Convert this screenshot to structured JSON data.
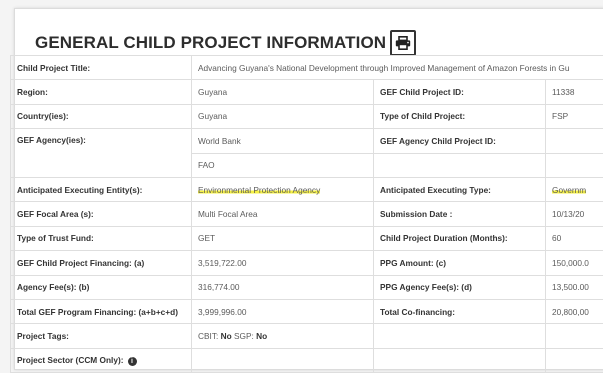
{
  "section": {
    "title": "GENERAL CHILD PROJECT INFORMATION",
    "print_icon": "printer-icon"
  },
  "fields": {
    "child_project_title": {
      "label": "Child Project Title:",
      "value": "Advancing Guyana's National Development through Improved Management of Amazon Forests in Gu"
    },
    "region": {
      "label": "Region:",
      "value": "Guyana"
    },
    "gef_child_project_id": {
      "label": "GEF Child Project ID:",
      "value": "11338"
    },
    "countries": {
      "label": "Country(ies):",
      "value": "Guyana"
    },
    "type_of_child_project": {
      "label": "Type of Child Project:",
      "value": "FSP"
    },
    "gef_agencies": {
      "label": "GEF Agency(ies):",
      "values": [
        "World Bank",
        "FAO"
      ]
    },
    "gef_agency_child_project_id": {
      "label": "GEF Agency Child Project ID:",
      "value": ""
    },
    "anticipated_executing_entities": {
      "label": "Anticipated Executing Entity(s):",
      "value": "Environmental Protection Agency"
    },
    "anticipated_executing_type": {
      "label": "Anticipated Executing Type:",
      "value": "Governm"
    },
    "gef_focal_area": {
      "label": "GEF Focal Area (s):",
      "value": "Multi Focal Area"
    },
    "submission_date": {
      "label": "Submission Date :",
      "value": "10/13/20"
    },
    "type_of_trust_fund": {
      "label": "Type of Trust Fund:",
      "value": "GET"
    },
    "child_project_duration": {
      "label": "Child Project Duration (Months):",
      "value": "60"
    },
    "gef_child_project_financing": {
      "label": "GEF Child Project Financing: (a)",
      "value": "3,519,722.00"
    },
    "ppg_amount": {
      "label": "PPG Amount: (c)",
      "value": "150,000.0"
    },
    "agency_fees": {
      "label": "Agency Fee(s): (b)",
      "value": "316,774.00"
    },
    "ppg_agency_fees": {
      "label": "PPG Agency Fee(s): (d)",
      "value": "13,500.00"
    },
    "total_gef_program_financing": {
      "label": "Total GEF Program Financing: (a+b+c+d)",
      "value": "3,999,996.00"
    },
    "total_cofinancing": {
      "label": "Total Co-financing:",
      "value": "20,800,00"
    },
    "project_tags": {
      "label": "Project Tags:",
      "cbit_label": "CBIT:",
      "cbit_value": "No",
      "sgp_label": "SGP:",
      "sgp_value": "No"
    },
    "project_sector": {
      "label": "Project Sector (CCM Only):",
      "info_icon": "info-icon"
    }
  },
  "colors": {
    "highlight": "#f5f042",
    "border": "#dedede"
  }
}
